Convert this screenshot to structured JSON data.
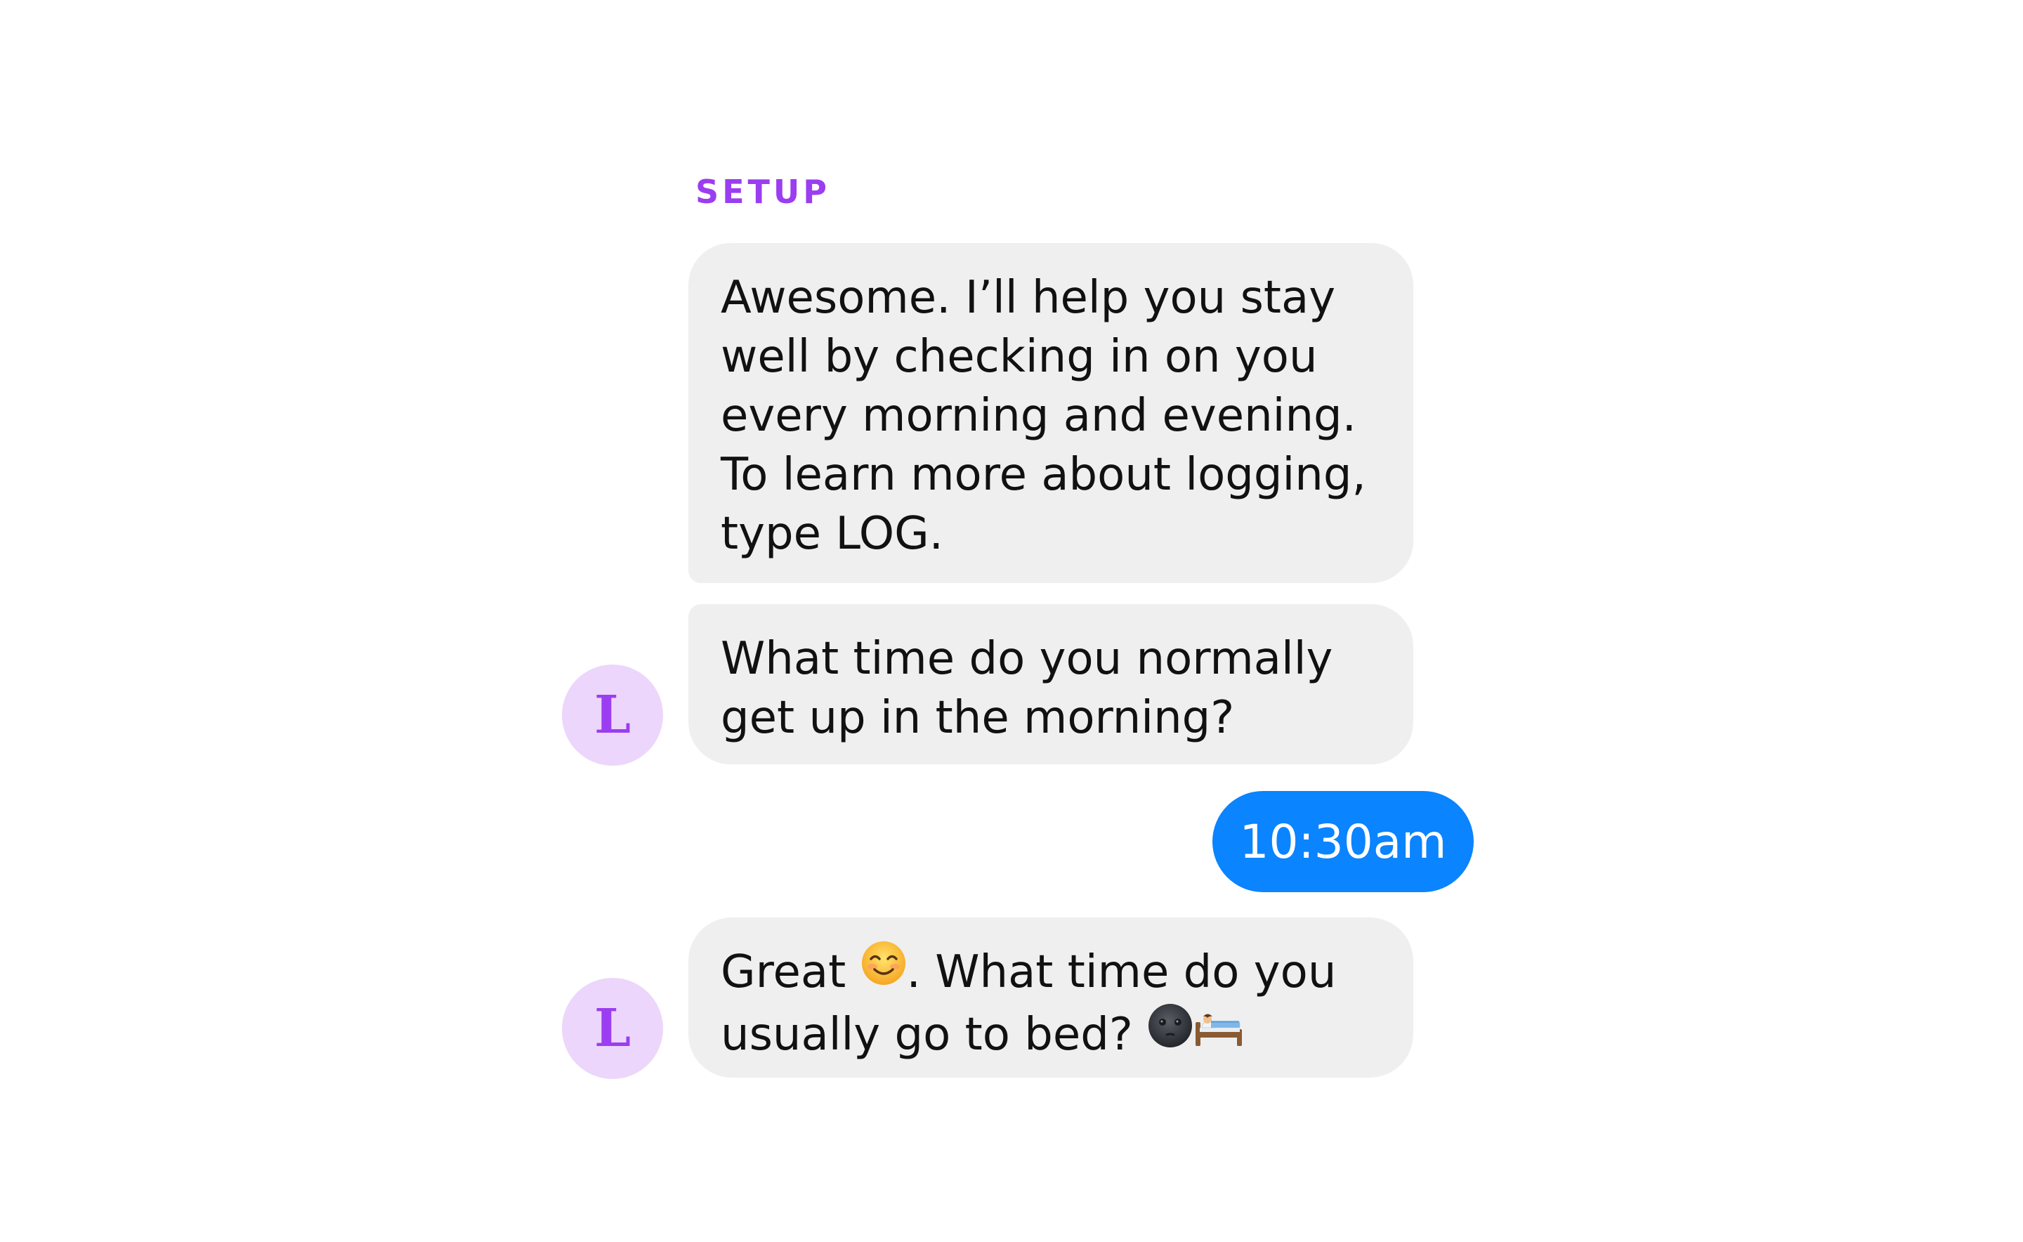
{
  "section": {
    "label": "SETUP"
  },
  "messages": [
    {
      "from": "bot",
      "lines": [
        "Awesome. I’ll help you stay",
        "well by checking in on you",
        "every morning and evening.",
        "To learn more about logging,",
        "type LOG."
      ]
    },
    {
      "from": "bot",
      "lines": [
        "What time do you normally",
        "get up in the morning?"
      ]
    },
    {
      "from": "user",
      "text": "10:30am"
    },
    {
      "from": "bot",
      "line1_before_emoji": "Great",
      "line1_after_emoji": ". What time do you",
      "line2": "usually go to bed?",
      "emojis": [
        "smiling-face-icon",
        "new-moon-face-icon",
        "bed-icon"
      ]
    }
  ],
  "avatar": {
    "initial": "L"
  },
  "colors": {
    "accent": "#9b3df0",
    "avatar_bg": "#ecd6fb",
    "bubble_bg": "#efefef",
    "outgoing_bg": "#0a84ff"
  }
}
